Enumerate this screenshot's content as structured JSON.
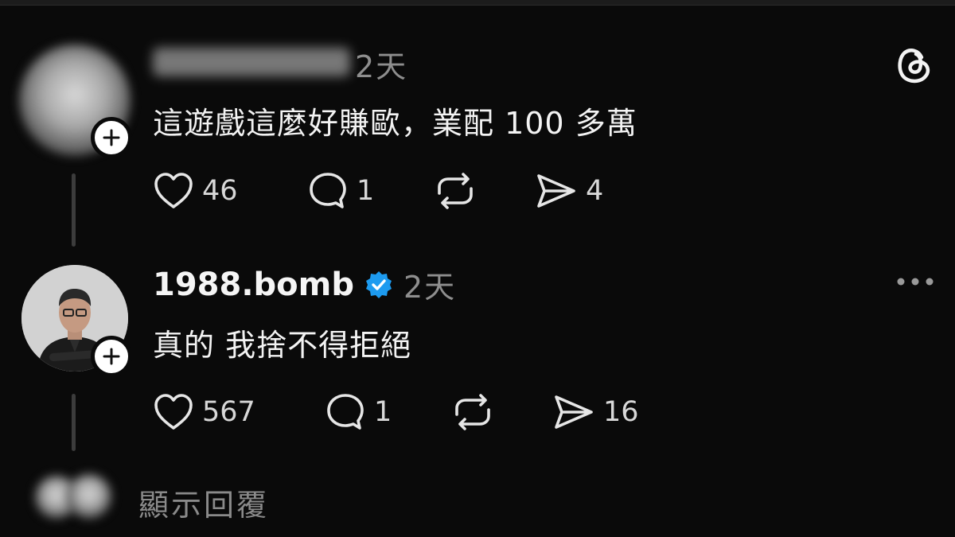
{
  "posts": [
    {
      "username": "",
      "time": "2天",
      "text": "這遊戲這麼好賺歐，業配 100 多萬",
      "likes": "46",
      "comments": "1",
      "shares": "4"
    },
    {
      "username": "1988.bomb",
      "verified": true,
      "time": "2天",
      "text": "真的 我捨不得拒絕",
      "likes": "567",
      "comments": "1",
      "shares": "16"
    }
  ],
  "show_replies_label": "顯示回覆",
  "colors": {
    "background": "#0a0a0a",
    "verified_badge": "#1d9bf0",
    "muted_text": "#8e8e8e"
  },
  "icons": [
    "threads-logo-icon",
    "plus-icon",
    "heart-icon",
    "comment-icon",
    "repost-icon",
    "share-icon",
    "verified-badge-icon",
    "more-options-icon"
  ]
}
